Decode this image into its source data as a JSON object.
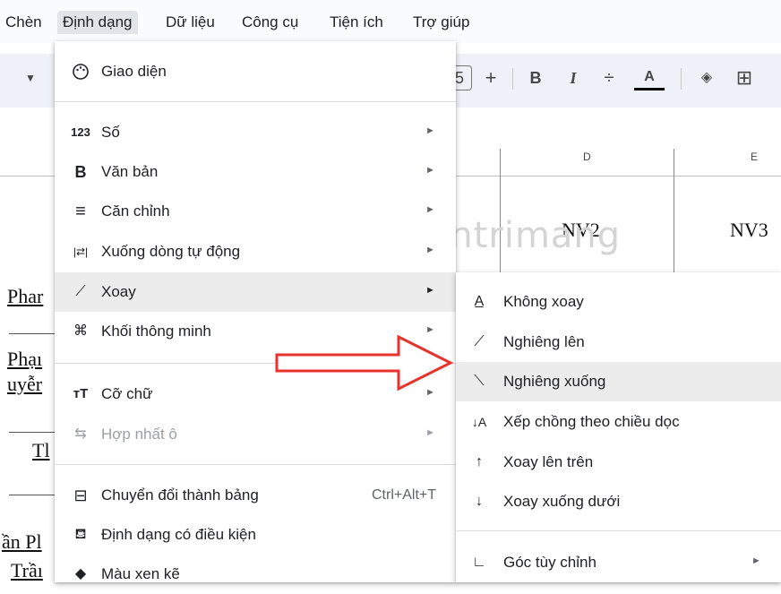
{
  "menubar": {
    "items": [
      "Chèn",
      "Định dạng",
      "Dữ liệu",
      "Công cụ",
      "Tiện ích",
      "Trợ giúp"
    ]
  },
  "toolbar": {
    "font_size_partial": "5",
    "plus": "+",
    "bold": "B",
    "italic": "I",
    "strike": "÷",
    "textcolor": "A",
    "fill": "◈",
    "borders": "⊞"
  },
  "sheet": {
    "col_d": "D",
    "col_e": "E",
    "nv2": "NV2",
    "nv3": "NV3",
    "left_cells": [
      "Phar",
      "Phạı",
      "uyễr",
      "Tl",
      "ần Pl",
      "Trầı"
    ]
  },
  "watermark": "Quantrimang",
  "format_menu": {
    "items": [
      {
        "icon": "palette-icon",
        "label": "Giao diện"
      },
      {
        "icon": "number-format-icon",
        "glyph": "123",
        "label": "Số",
        "arrow": "►"
      },
      {
        "icon": "bold-icon",
        "glyph": "B",
        "label": "Văn bản",
        "arrow": "►"
      },
      {
        "icon": "align-icon",
        "glyph": "≡",
        "label": "Căn chỉnh",
        "arrow": "►"
      },
      {
        "icon": "wrap-icon",
        "glyph": "|⇄|",
        "label": "Xuống dòng tự động",
        "arrow": "►"
      },
      {
        "icon": "rotate-icon",
        "glyph": "⟋",
        "label": "Xoay",
        "arrow": "►"
      },
      {
        "icon": "smart-chip-icon",
        "glyph": "⌘",
        "label": "Khối thông minh",
        "arrow": "►"
      },
      {
        "icon": "font-size-icon",
        "glyph": "тT",
        "label": "Cỡ chữ",
        "arrow": "►"
      },
      {
        "icon": "merge-icon",
        "glyph": "⇆",
        "label": "Hợp nhất ô",
        "arrow": "►"
      },
      {
        "icon": "table-icon",
        "glyph": "⊟",
        "label": "Chuyển đổi thành bảng",
        "shortcut": "Ctrl+Alt+T"
      },
      {
        "icon": "paint-roller-icon",
        "glyph": "⛾",
        "label": "Định dạng có điều kiện"
      },
      {
        "icon": "drop-icon",
        "glyph": "◆",
        "label": "Màu xen kẽ"
      }
    ]
  },
  "rotation_submenu": {
    "items": [
      {
        "icon": "no-rotate-icon",
        "glyph": "A̲",
        "label": "Không xoay"
      },
      {
        "icon": "tilt-up-icon",
        "glyph": "⟋",
        "label": "Nghiêng lên"
      },
      {
        "icon": "tilt-down-icon",
        "glyph": "⟍",
        "label": "Nghiêng xuống"
      },
      {
        "icon": "stack-vertical-icon",
        "glyph": "↓A",
        "label": "Xếp chồng theo chiều dọc"
      },
      {
        "icon": "rotate-up-icon",
        "glyph": "↑",
        "label": "Xoay lên trên"
      },
      {
        "icon": "rotate-down-icon",
        "glyph": "↓",
        "label": "Xoay xuống dưới"
      },
      {
        "icon": "custom-angle-icon",
        "glyph": "∟",
        "label": "Góc tùy chỉnh",
        "arrow": "►"
      }
    ]
  },
  "colors": {
    "arrow": "#e8322b",
    "hover": "#ececec",
    "menubar_active": "#e1e5ea"
  }
}
